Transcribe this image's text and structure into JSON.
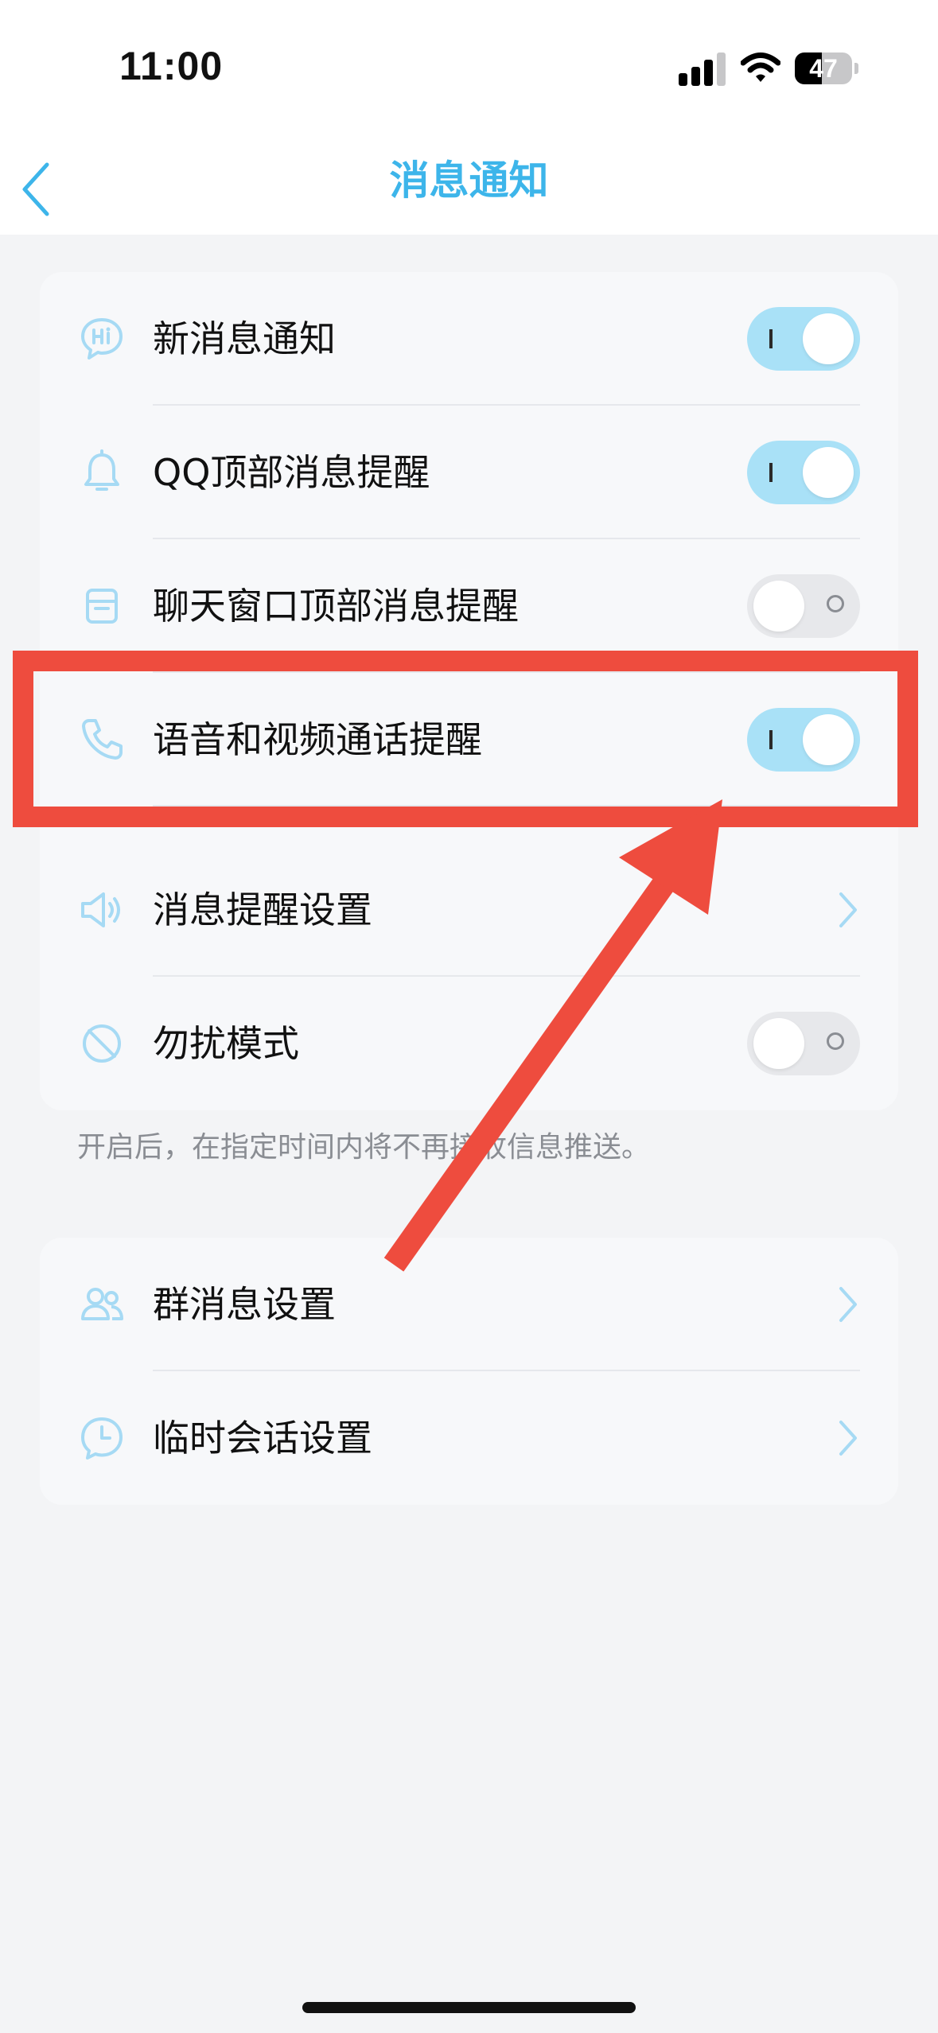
{
  "status_bar": {
    "time": "11:00",
    "battery": "47",
    "battery_level": 0.47
  },
  "nav": {
    "title": "消息通知",
    "back_icon": "chevron-left-icon"
  },
  "section1": [
    {
      "label": "新消息通知",
      "icon": "hi-bubble-icon",
      "control": "toggle",
      "on": true
    },
    {
      "label": "QQ顶部消息提醒",
      "icon": "bell-icon",
      "control": "toggle",
      "on": true
    },
    {
      "label": "聊天窗口顶部消息提醒",
      "icon": "window-icon",
      "control": "toggle",
      "on": false
    },
    {
      "label": "语音和视频通话提醒",
      "icon": "phone-icon",
      "control": "toggle",
      "on": true
    },
    {
      "label": "消息提醒设置",
      "icon": "speaker-icon",
      "control": "chevron"
    },
    {
      "label": "勿扰模式",
      "icon": "do-not-disturb-icon",
      "control": "toggle",
      "on": false
    }
  ],
  "caption": "开启后，在指定时间内将不再接收信息推送。",
  "section2": [
    {
      "label": "群消息设置",
      "icon": "group-icon",
      "control": "chevron"
    },
    {
      "label": "临时会话设置",
      "icon": "clock-bubble-icon",
      "control": "chevron"
    }
  ],
  "colors": {
    "accent": "#3db5ea",
    "toggle_on": "#a9e1f7",
    "toggle_off": "#e7e8eb",
    "annotation": "#ee4c3e",
    "icon": "#a6daf4"
  }
}
